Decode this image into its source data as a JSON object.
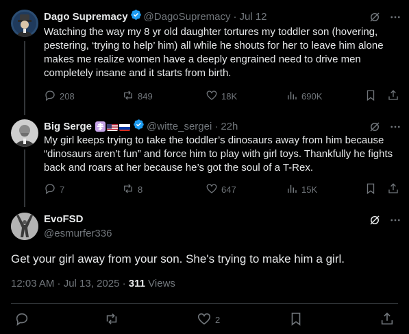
{
  "tweets": [
    {
      "display_name": "Dago Supremacy",
      "handle": "@DagoSupremacy",
      "separator": "·",
      "time": "Jul 12",
      "text": "Watching the way my 8 yr old daughter tortures my toddler son (hovering, pestering, ‘trying to help’ him) all while he shouts for her to leave him alone makes me realize women have a deeply engrained need to drive men completely insane and it starts from birth.",
      "replies": "208",
      "reposts": "849",
      "likes": "18K",
      "views": "690K"
    },
    {
      "display_name": "Big Serge",
      "handle": "@witte_sergei",
      "separator": "·",
      "time": "22h",
      "text": "My girl keeps trying to take the toddler’s dinosaurs away from him because “dinosaurs aren’t fun” and force him to play with girl toys. Thankfully he fights back and roars at her because he’s got the soul of a T-Rex.",
      "replies": "7",
      "reposts": "8",
      "likes": "647",
      "views": "15K"
    }
  ],
  "main_tweet": {
    "display_name": "EvoFSD",
    "handle": "@esmurfer336",
    "text": "Get your girl away from your son. She's trying to make him a girl.",
    "timestamp": "12:03 AM · Jul 13, 2025 ·",
    "views_count": "311",
    "views_label": "Views",
    "likes": "2"
  },
  "colors": {
    "background": "#000000",
    "text": "#e7e9ea",
    "muted": "#71767b",
    "verified_blue": "#1d9bf0",
    "line": "#333639"
  },
  "icons": [
    "grok-icon",
    "more-icon",
    "reply-icon",
    "repost-icon",
    "like-icon",
    "views-icon",
    "bookmark-icon",
    "share-icon",
    "verified-badge-icon",
    "orthodox-cross-flag-icon",
    "us-flag-icon",
    "russia-flag-icon"
  ]
}
